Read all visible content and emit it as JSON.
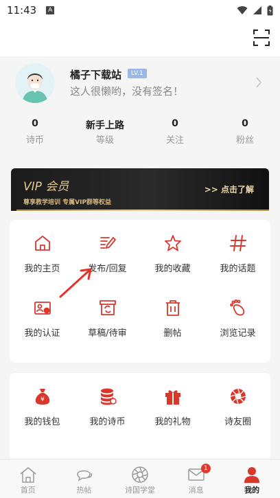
{
  "status_bar": {
    "time": "11:43",
    "indicator": "A"
  },
  "profile": {
    "name": "橘子下载站",
    "level": "LV.1",
    "signature": "这人很懒哟，没有签名！",
    "stats": [
      {
        "value": "0",
        "label": "诗币"
      },
      {
        "value": "新手上路",
        "label": "等级"
      },
      {
        "value": "0",
        "label": "关注"
      },
      {
        "value": "0",
        "label": "粉丝"
      }
    ]
  },
  "vip": {
    "title": "VIP 会员",
    "subtitle": "尊享教学培训 专属VIP群等权益",
    "cta": ">> 点击了解"
  },
  "menu1": [
    {
      "label": "我的主页",
      "icon": "home-icon"
    },
    {
      "label": "发布/回复",
      "icon": "edit-icon"
    },
    {
      "label": "我的收藏",
      "icon": "star-icon"
    },
    {
      "label": "我的话题",
      "icon": "hashtag-icon"
    },
    {
      "label": "我的认证",
      "icon": "id-card-icon"
    },
    {
      "label": "草稿/待审",
      "icon": "draft-box-icon"
    },
    {
      "label": "删帖",
      "icon": "trash-icon"
    },
    {
      "label": "浏览记录",
      "icon": "footprint-icon"
    }
  ],
  "menu2": [
    {
      "label": "我的钱包",
      "icon": "money-bag-icon"
    },
    {
      "label": "我的诗币",
      "icon": "coins-icon"
    },
    {
      "label": "我的礼物",
      "icon": "gift-icon"
    },
    {
      "label": "诗友圈",
      "icon": "aperture-icon"
    }
  ],
  "tabs": [
    {
      "label": "首页",
      "icon": "home-tab-icon"
    },
    {
      "label": "热帖",
      "icon": "chat-bubble-icon"
    },
    {
      "label": "诗国学堂",
      "icon": "aperture-tab-icon"
    },
    {
      "label": "消息",
      "icon": "mail-icon",
      "badge": "1"
    },
    {
      "label": "我的",
      "icon": "user-icon",
      "active": true
    }
  ],
  "colors": {
    "accent": "#d8372b",
    "vip_gold": "#e7c98d",
    "badge_blue": "#9bb7e6"
  }
}
